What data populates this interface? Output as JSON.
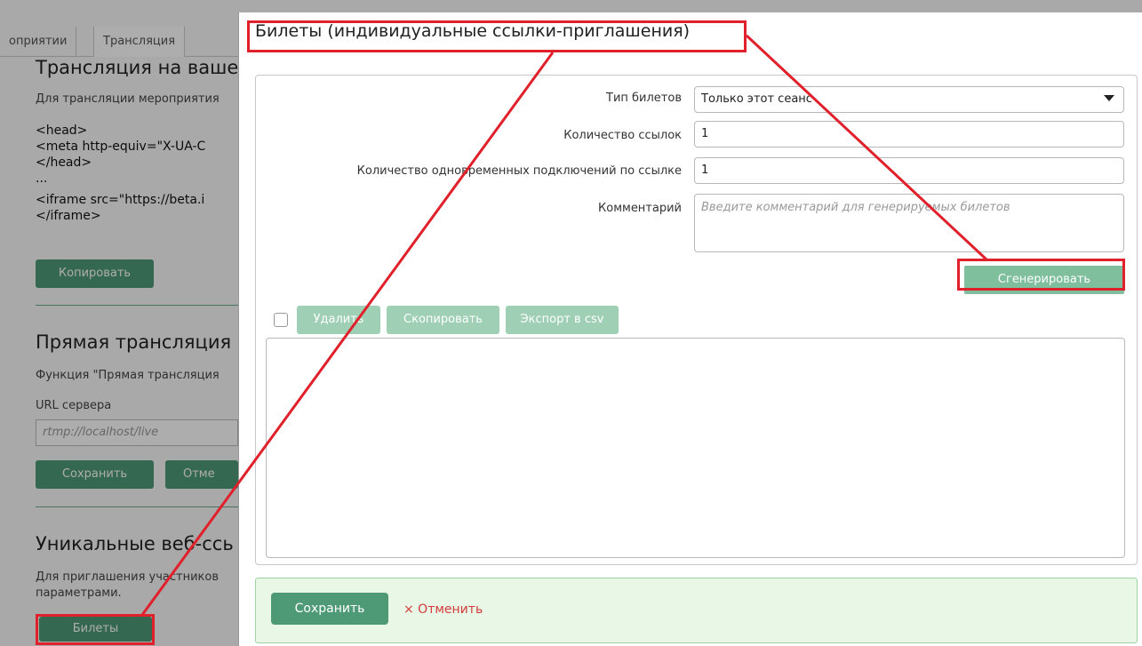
{
  "background_page": {
    "tabs": [
      "оприятии",
      "Трансляция"
    ],
    "stream_section": {
      "heading": "Трансляция на ваше",
      "description": "Для трансляции мероприятия",
      "code_lines": [
        "<head>",
        "<meta http-equiv=\"X-UA-C",
        "</head>",
        "...",
        "<iframe src=\"https://beta.i",
        "</iframe>"
      ],
      "copy_button": "Копировать"
    },
    "live_section": {
      "heading": "Прямая трансляция",
      "description": "Функция \"Прямая трансляция",
      "url_label": "URL сервера",
      "url_value": "rtmp://localhost/live",
      "save_button": "Сохранить",
      "cancel_button": "Отме"
    },
    "links_section": {
      "heading": "Уникальные веб-ссь",
      "description_line1": "Для приглашения участников",
      "description_line2": "параметрами.",
      "tickets_button": "Билеты"
    }
  },
  "modal": {
    "title": "Билеты (индивидуальные ссылки-приглашения)",
    "fields": {
      "ticket_type": {
        "label": "Тип билетов",
        "value": "Только этот сеанс"
      },
      "link_count": {
        "label": "Количество ссылок",
        "value": "1"
      },
      "concurrent": {
        "label": "Количество одновременных подключений по ссылке",
        "value": "1"
      },
      "comment": {
        "label": "Комментарий",
        "placeholder": "Введите комментарий для генерируемых билетов"
      }
    },
    "generate_button": "Сгенерировать",
    "toolbar": {
      "delete": "Удалить",
      "copy": "Скопировать",
      "export": "Экспорт в csv"
    },
    "footer": {
      "save": "Сохранить",
      "cancel": "× Отменить"
    }
  },
  "colors": {
    "primary_green": "#4f9a76",
    "light_green": "#7fbf9e",
    "footer_bg": "#e9f7e6",
    "annotation_red": "#e0202a",
    "cancel_red": "#d23b3b"
  }
}
